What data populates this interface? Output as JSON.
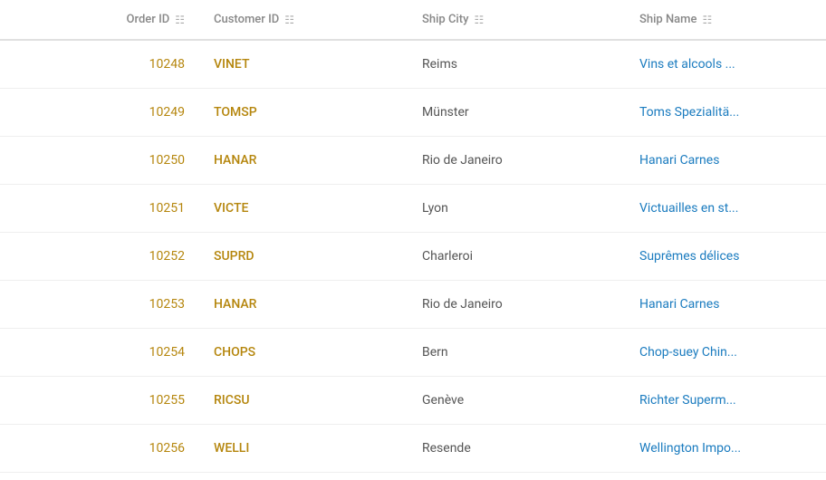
{
  "columns": [
    {
      "key": "order_id",
      "label": "Order ID"
    },
    {
      "key": "customer_id",
      "label": "Customer ID"
    },
    {
      "key": "ship_city",
      "label": "Ship City"
    },
    {
      "key": "ship_name",
      "label": "Ship Name"
    }
  ],
  "rows": [
    {
      "order_id": "10248",
      "customer_id": "VINET",
      "ship_city": "Reims",
      "ship_name": "Vins et alcools ..."
    },
    {
      "order_id": "10249",
      "customer_id": "TOMSP",
      "ship_city": "Münster",
      "ship_name": "Toms Spezialitä..."
    },
    {
      "order_id": "10250",
      "customer_id": "HANAR",
      "ship_city": "Rio de Janeiro",
      "ship_name": "Hanari Carnes"
    },
    {
      "order_id": "10251",
      "customer_id": "VICTE",
      "ship_city": "Lyon",
      "ship_name": "Victuailles en st..."
    },
    {
      "order_id": "10252",
      "customer_id": "SUPRD",
      "ship_city": "Charleroi",
      "ship_name": "Suprêmes délices"
    },
    {
      "order_id": "10253",
      "customer_id": "HANAR",
      "ship_city": "Rio de Janeiro",
      "ship_name": "Hanari Carnes"
    },
    {
      "order_id": "10254",
      "customer_id": "CHOPS",
      "ship_city": "Bern",
      "ship_name": "Chop-suey Chin..."
    },
    {
      "order_id": "10255",
      "customer_id": "RICSU",
      "ship_city": "Genève",
      "ship_name": "Richter Superm..."
    },
    {
      "order_id": "10256",
      "customer_id": "WELLI",
      "ship_city": "Resende",
      "ship_name": "Wellington Impo..."
    }
  ],
  "filter_icon": "≡"
}
